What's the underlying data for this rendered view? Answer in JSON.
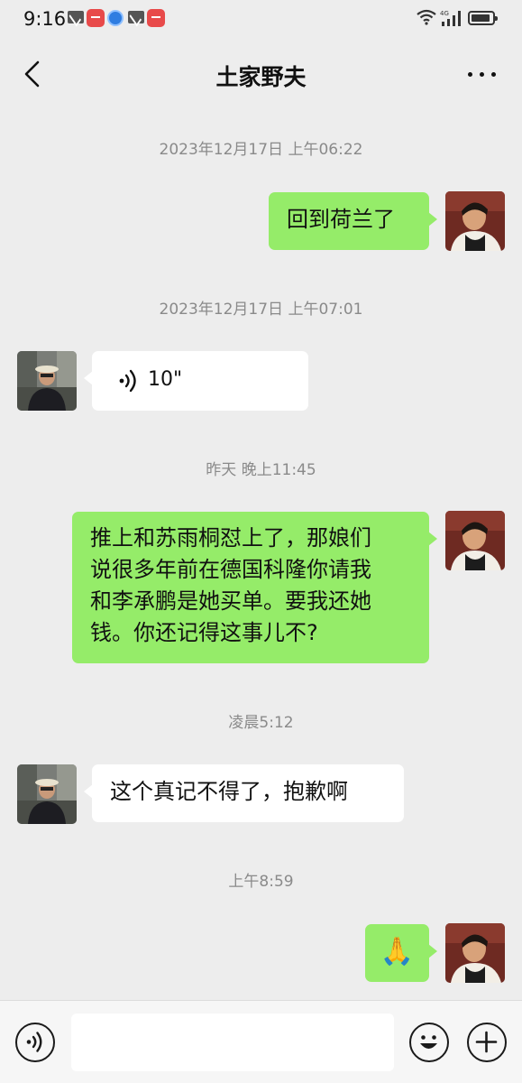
{
  "status_bar": {
    "time": "9:16",
    "network_label": "4G"
  },
  "header": {
    "title": "土家野夫",
    "back_icon": "chevron-left-icon",
    "more_icon": "more-dots-icon"
  },
  "messages": [
    {
      "type": "timestamp",
      "text": "2023年12月17日 上午06:22"
    },
    {
      "type": "text",
      "sender": "me",
      "text": "回到荷兰了"
    },
    {
      "type": "timestamp",
      "text": "2023年12月17日 上午07:01"
    },
    {
      "type": "voice",
      "sender": "them",
      "duration": "10\""
    },
    {
      "type": "timestamp",
      "text": "昨天 晚上11:45"
    },
    {
      "type": "text",
      "sender": "me",
      "lines": [
        "推上和苏雨桐怼上了，那娘们",
        "说很多年前在德国科隆你请我",
        "和李承鹏是她买单。要我还她",
        "钱。你还记得这事儿不?"
      ]
    },
    {
      "type": "timestamp",
      "text": "凌晨5:12"
    },
    {
      "type": "text",
      "sender": "them",
      "text": "这个真记不得了，抱歉啊"
    },
    {
      "type": "timestamp",
      "text": "上午8:59"
    },
    {
      "type": "emoji",
      "sender": "me",
      "emoji": "🙏"
    }
  ],
  "input_bar": {
    "voice_icon": "voice-icon",
    "emoji_icon": "smiley-icon",
    "plus_icon": "plus-icon",
    "input_value": ""
  },
  "colors": {
    "background": "#ededed",
    "my_bubble": "#95ec69",
    "their_bubble": "#ffffff",
    "timestamp_text": "#8a8a8a"
  }
}
